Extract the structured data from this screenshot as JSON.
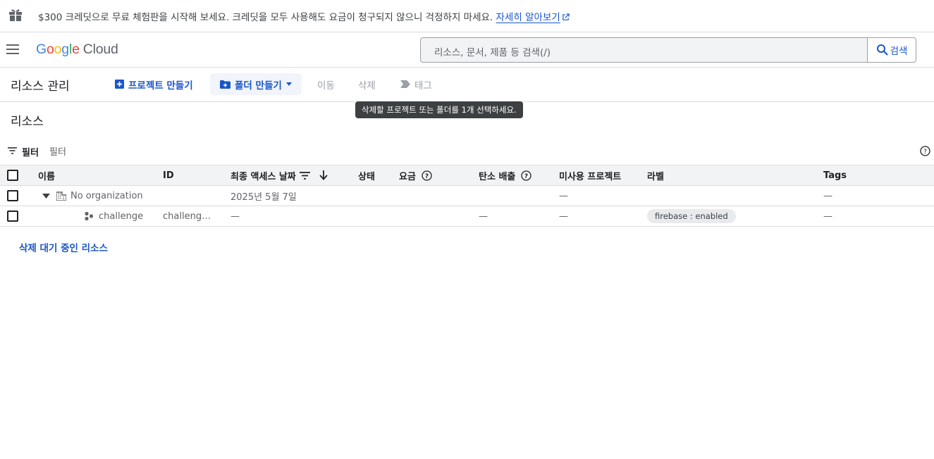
{
  "banner": {
    "message": "$300 크레딧으로 무료 체험판을 시작해 보세요. 크레딧을 모두 사용해도 요금이 청구되지 않으니 걱정하지 마세요.",
    "learn_more": "자세히 알아보기",
    "icon": "gift-icon"
  },
  "header": {
    "logo_google": [
      "G",
      "o",
      "o",
      "g",
      "l",
      "e"
    ],
    "logo_product": "Cloud",
    "search_placeholder": "리소스, 문서, 제품 등 검색(/)",
    "search_button": "검색"
  },
  "toolbar": {
    "title": "리소스 관리",
    "create_project": "프로젝트 만들기",
    "create_folder": "폴더 만들기",
    "move": "이동",
    "delete": "삭제",
    "tag": "태그",
    "tooltip": "삭제할 프로젝트 또는 폴더를 1개 선택하세요."
  },
  "resources": {
    "title": "리소스",
    "filter_label": "필터",
    "filter_placeholder": "필터"
  },
  "table": {
    "columns": {
      "name": "이름",
      "id": "ID",
      "last_access": "최종 액세스 날짜",
      "status": "상태",
      "billing": "요금",
      "carbon": "탄소 배출",
      "unused": "미사용 프로젝트",
      "labels": "라벨",
      "tags": "Tags"
    },
    "rows": [
      {
        "name": "No organization",
        "id": "",
        "last_access": "2025년 5월 7일",
        "status": "",
        "billing": "",
        "carbon": "",
        "unused": "—",
        "label": "",
        "tags": "—",
        "icon": "organization-icon"
      },
      {
        "name": "challenge",
        "id": "challeng…",
        "last_access": "—",
        "status": "",
        "billing": "",
        "carbon": "—",
        "unused": "—",
        "label": "firebase : enabled",
        "tags": "—",
        "icon": "project-icon"
      }
    ]
  },
  "pending_deletion": "삭제 대기 중인 리소스",
  "colors": {
    "accent": "#1a56c8",
    "google_blue": "#4285f4",
    "google_red": "#ea4335",
    "google_yellow": "#fbbc04",
    "google_green": "#34a853"
  }
}
